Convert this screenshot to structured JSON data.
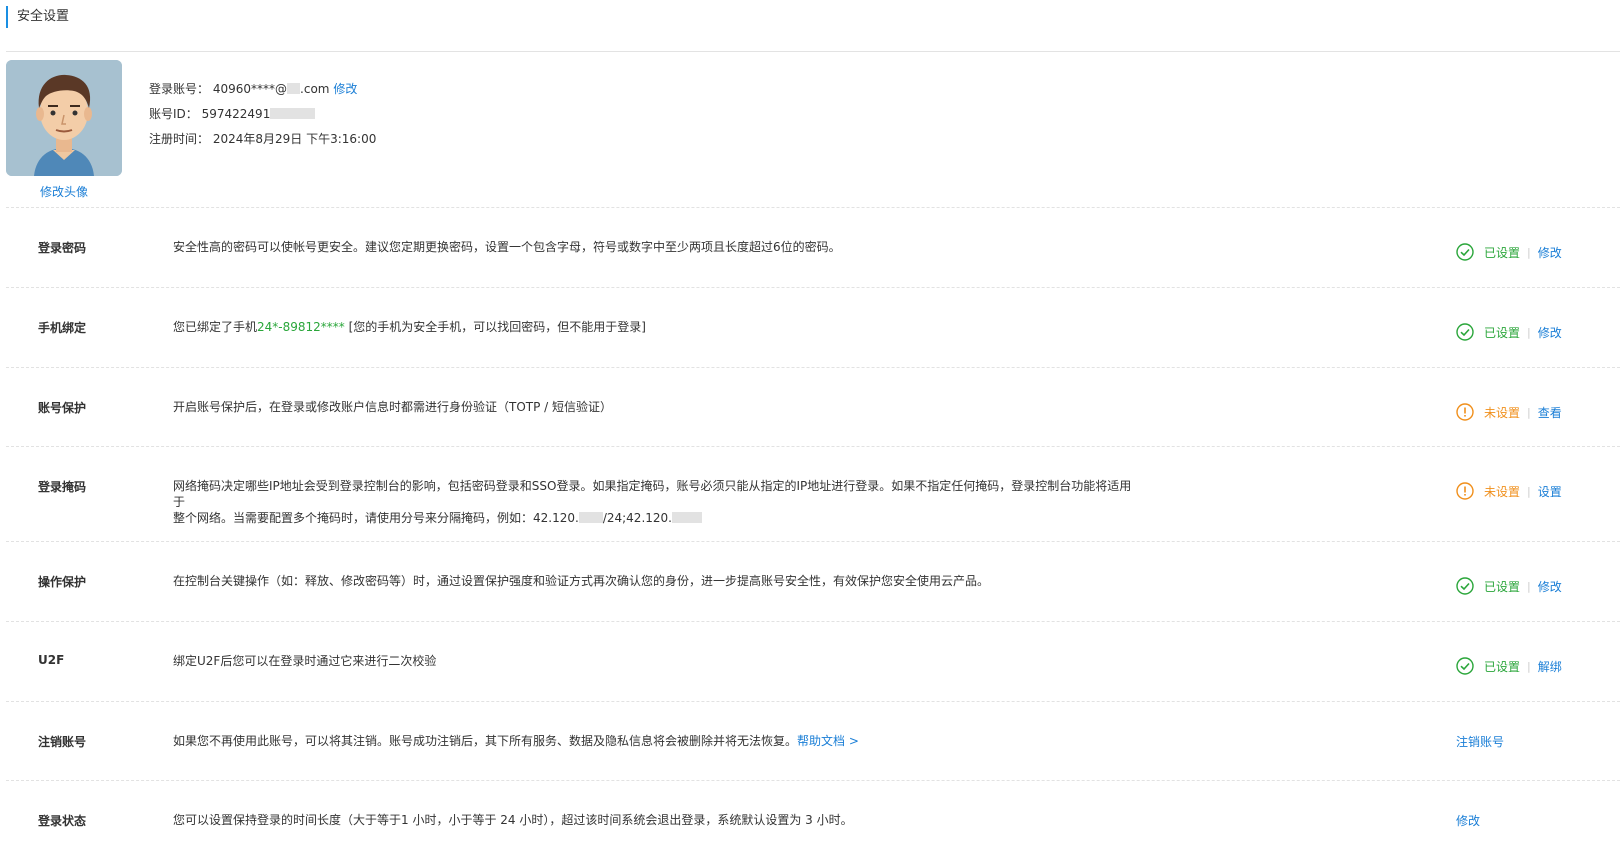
{
  "page": {
    "title": "安全设置"
  },
  "profile": {
    "change_avatar": "修改头像",
    "login_account_label": "登录账号：",
    "login_account_prefix": "40960****@",
    "login_account_suffix": ".com",
    "edit_link": "修改",
    "account_id_label": "账号ID：",
    "account_id_value": "597422491",
    "register_label": "注册时间：",
    "register_value": "2024年8月29日 下午3:16:00"
  },
  "rows": [
    {
      "title": "登录密码",
      "desc": "安全性高的密码可以使帐号更安全。建议您定期更换密码，设置一个包含字母，符号或数字中至少两项且长度超过6位的密码。",
      "status": "已设置",
      "action": "修改"
    },
    {
      "title": "手机绑定",
      "desc_pre": "您已绑定了手机",
      "desc_phone": "24*-89812****",
      "desc_post": " [您的手机为安全手机，可以找回密码，但不能用于登录]",
      "status": "已设置",
      "action": "修改"
    },
    {
      "title": "账号保护",
      "desc": "开启账号保护后，在登录或修改账户信息时都需进行身份验证（TOTP / 短信验证）",
      "status": "未设置",
      "action": "查看"
    },
    {
      "title": "登录掩码",
      "desc_line1": "网络掩码决定哪些IP地址会受到登录控制台的影响，包括密码登录和SSO登录。如果指定掩码，账号必须只能从指定的IP地址进行登录。如果不指定任何掩码，登录控制台功能将适用于",
      "desc_line2_pre": "整个网络。当需要配置多个掩码时，请使用分号来分隔掩码，例如：42.120.",
      "desc_line2_mid": "/24;42.120.",
      "status": "未设置",
      "action": "设置"
    },
    {
      "title": "操作保护",
      "desc": "在控制台关键操作（如：释放、修改密码等）时，通过设置保护强度和验证方式再次确认您的身份，进一步提高账号安全性，有效保护您安全使用云产品。",
      "status": "已设置",
      "action": "修改"
    },
    {
      "title": "U2F",
      "desc": "绑定U2F后您可以在登录时通过它来进行二次校验",
      "status": "已设置",
      "action": "解绑"
    },
    {
      "title": "注销账号",
      "desc": "如果您不再使用此账号，可以将其注销。账号成功注销后，其下所有服务、数据及隐私信息将会被删除并将无法恢复。",
      "help_link": "帮助文档 >",
      "action": "注销账号"
    },
    {
      "title": "登录状态",
      "desc": "您可以设置保持登录的时间长度（大于等于1 小时，小于等于 24 小时），超过该时间系统会退出登录，系统默认设置为 3 小时。",
      "action": "修改"
    }
  ],
  "colors": {
    "accent": "#1a7ed6",
    "ok": "#2aa63a",
    "warn": "#f08f1b"
  },
  "icons": {
    "ok": "check-circle-icon",
    "warn": "exclamation-circle-icon"
  }
}
